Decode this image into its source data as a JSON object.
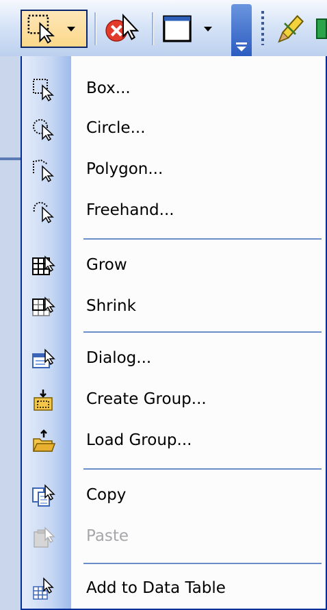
{
  "toolbar": {
    "buttons": [
      {
        "name": "select-features-tool",
        "icon": "select-box-icon",
        "pressed": true
      },
      {
        "name": "clear-selection",
        "icon": "clear-selection-icon"
      },
      {
        "name": "rectangle-tool",
        "icon": "rectangle-icon"
      },
      {
        "name": "toolbar-overflow",
        "icon": "chevron-down-icon"
      },
      {
        "name": "edit-tool",
        "icon": "pencil-icon"
      }
    ]
  },
  "menu": {
    "items": [
      {
        "label": "Box...",
        "icon": "select-box-icon",
        "enabled": true
      },
      {
        "label": "Circle...",
        "icon": "select-circle-icon",
        "enabled": true
      },
      {
        "label": "Polygon...",
        "icon": "select-polygon-icon",
        "enabled": true
      },
      {
        "label": "Freehand...",
        "icon": "select-freehand-icon",
        "enabled": true
      },
      {
        "label": "Grow",
        "icon": "grid-grow-icon",
        "enabled": true
      },
      {
        "label": "Shrink",
        "icon": "grid-shrink-icon",
        "enabled": true
      },
      {
        "label": "Dialog...",
        "icon": "dialog-icon",
        "enabled": true
      },
      {
        "label": "Create Group...",
        "icon": "create-group-icon",
        "enabled": true
      },
      {
        "label": "Load Group...",
        "icon": "load-group-icon",
        "enabled": true
      },
      {
        "label": "Copy",
        "icon": "copy-icon",
        "enabled": true
      },
      {
        "label": "Paste",
        "icon": "paste-icon",
        "enabled": false
      },
      {
        "label": "Add to Data Table",
        "icon": "add-to-table-icon",
        "enabled": true
      }
    ]
  },
  "colors": {
    "menu_border": "#002d96",
    "separator": "#6a8cc8",
    "disabled_text": "#a7a6aa",
    "pressed_button": "#fbd88a"
  }
}
